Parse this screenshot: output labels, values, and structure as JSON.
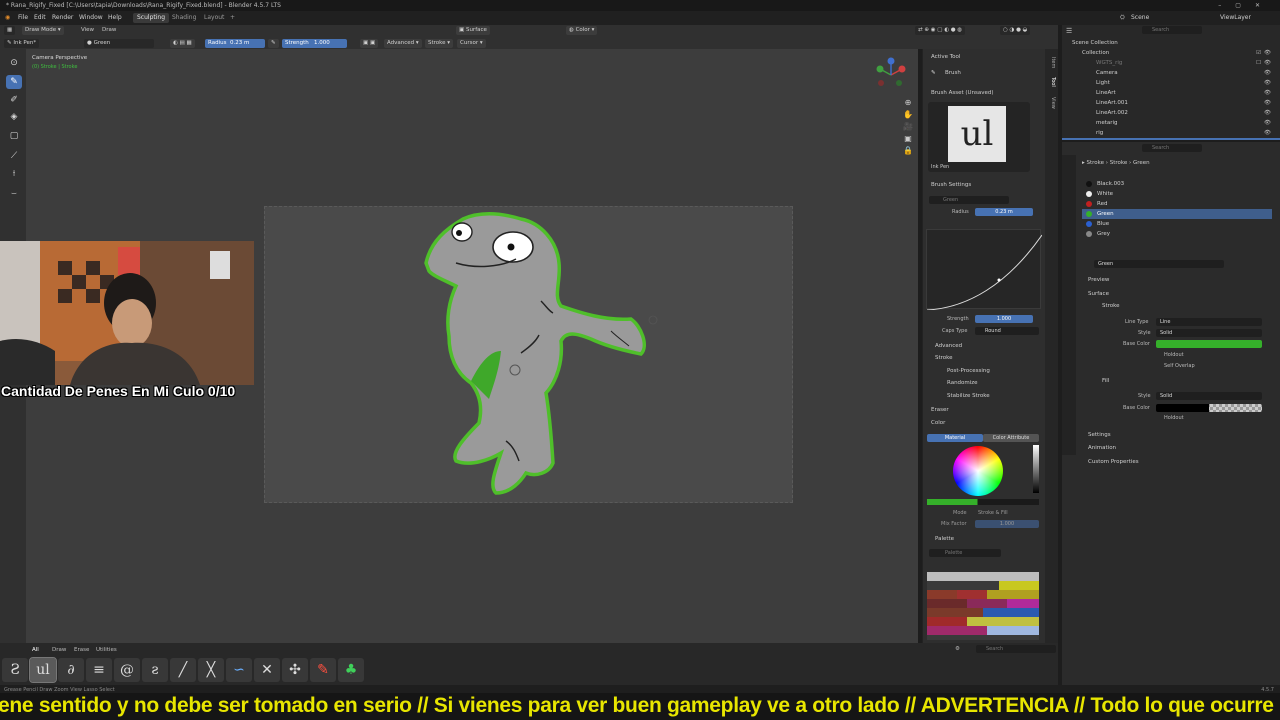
{
  "window": {
    "title": "* Rana_Rigify_Fixed [C:\\Users\\tapia\\Downloads\\Rana_Rigify_Fixed.blend] - Blender 4.5.7 LTS"
  },
  "menubar": {
    "items": [
      "File",
      "Edit",
      "Render",
      "Window",
      "Help"
    ],
    "workspaces": [
      "Sculpting",
      "Shading",
      "Layout"
    ],
    "add_tab": "+",
    "scene_label": "Scene",
    "view_layer_label": "ViewLayer"
  },
  "header": {
    "mode": "Draw Mode",
    "view": "View",
    "draw": "Draw",
    "surface": "Surface",
    "color_mode": "Color",
    "brush_name": "Ink Pen*",
    "material": "Green",
    "radius_label": "Radius",
    "radius_value": "0.23 m",
    "strength_label": "Strength",
    "strength_value": "1.000",
    "advanced": "Advanced",
    "stroke": "Stroke",
    "cursor": "Cursor",
    "search_placeholder": "Search"
  },
  "viewport": {
    "camera_label": "Camera Perspective",
    "sub_label": "(0) Stroke | Stroke"
  },
  "webcam": {
    "overlay_text": "Cantidad De Penes En Mi Culo 0/10"
  },
  "npanel": {
    "tabs": [
      "Item",
      "Tool",
      "View"
    ],
    "active_tool_header": "Active Tool",
    "active_tool": "Brush",
    "brush_asset_header": "Brush Asset (Unsaved)",
    "brush_asset_name": "Ink Pen",
    "brush_thumb_text": "ul",
    "brush_settings_header": "Brush Settings",
    "material_field": "Green",
    "radius_label": "Radius",
    "radius_value": "0.23 m",
    "strength_label": "Strength",
    "strength_value": "1.000",
    "caps_label": "Caps Type",
    "caps_value": "Round",
    "advanced": "Advanced",
    "stroke": "Stroke",
    "post_processing": "Post-Processing",
    "randomize": "Randomize",
    "stabilize": "Stabilize Stroke",
    "eraser": "Eraser",
    "color_header": "Color",
    "material_tab": "Material",
    "color_attr_tab": "Color Attribute",
    "mode_label": "Mode",
    "mode_value": "Stroke & Fill",
    "mix_label": "Mix Factor",
    "mix_value": "1.000",
    "palette_header": "Palette",
    "palette_field": "Palette"
  },
  "brushbar": {
    "tabs": [
      "All",
      "Draw",
      "Erase",
      "Utilities"
    ],
    "brushes": [
      "Ƨ",
      "ul",
      "∂",
      "≡",
      "@",
      "ƨ",
      "╱",
      "╳",
      "∽",
      "✕",
      "✣",
      "✎",
      "♣"
    ]
  },
  "statusbar": {
    "left": "Grease Pencil Draw    Zoom View    Lasso Select",
    "right": "4.5.7"
  },
  "ticker": {
    "text": "ene sentido y no debe ser tomado en serio // Si vienes para ver buen gameplay ve a otro lado //  ADVERTENCIA // Todo lo que ocurre en es"
  },
  "outliner": {
    "search_placeholder": "Search",
    "root": "Scene Collection",
    "collection": "Collection",
    "items": [
      "WGTS_rig",
      "Camera",
      "Light",
      "LineArt",
      "LineArt.001",
      "LineArt.002",
      "metarig",
      "rig"
    ]
  },
  "properties": {
    "breadcrumb": [
      "Stroke",
      "Stroke",
      "Green"
    ],
    "search_placeholder": "Search",
    "materials": [
      {
        "name": "Black.003",
        "color": "#111111"
      },
      {
        "name": "White",
        "color": "#eeeeee"
      },
      {
        "name": "Red",
        "color": "#c02020"
      },
      {
        "name": "Green",
        "color": "#35b02a"
      },
      {
        "name": "Blue",
        "color": "#2a5fd0"
      },
      {
        "name": "Grey",
        "color": "#888888"
      }
    ],
    "selected_material": "Green",
    "material_field": "Green",
    "preview": "Preview",
    "surface": "Surface",
    "stroke_check": "Stroke",
    "line_type_label": "Line Type",
    "line_type_value": "Line",
    "style_label": "Style",
    "style_value": "Solid",
    "base_color_label": "Base Color",
    "base_color_value": "#35b02a",
    "holdout": "Holdout",
    "self_overlap": "Self Overlap",
    "fill": "Fill",
    "fill_style_label": "Style",
    "fill_style_value": "Solid",
    "fill_base_color_label": "Base Color",
    "fill_holdout": "Holdout",
    "settings": "Settings",
    "animation": "Animation",
    "custom_properties": "Custom Properties"
  },
  "colors": {
    "accent": "#4772b3",
    "stroke_green": "#35b02a",
    "ticker_yellow": "#e8e600"
  }
}
